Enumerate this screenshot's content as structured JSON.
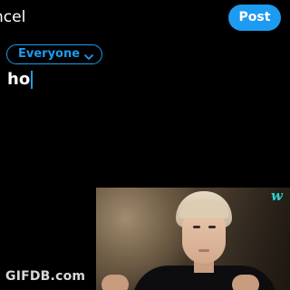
{
  "header": {
    "cancel_label": "ncel",
    "post_label": "Post"
  },
  "audience": {
    "label": "Everyone"
  },
  "compose": {
    "text": "ho"
  },
  "overlay": {
    "video_watermark": "w",
    "gif_watermark": "GIFDB.com"
  },
  "colors": {
    "accent": "#1d9bf0",
    "background": "#000000",
    "watermark": "#27d3d0"
  },
  "icons": {
    "audience_chevron": "chevron-down-icon"
  }
}
